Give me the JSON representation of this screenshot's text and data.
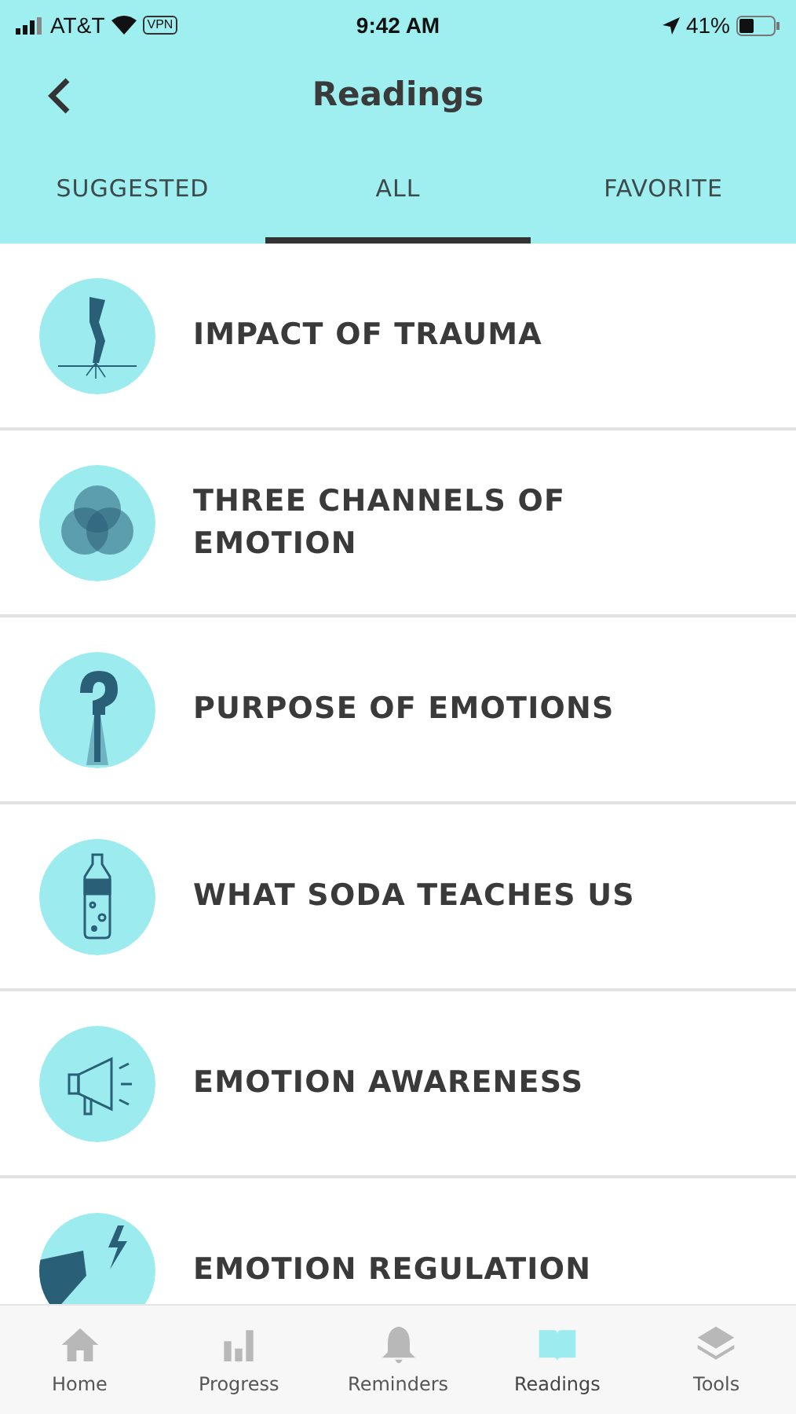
{
  "status_bar": {
    "carrier": "AT&T",
    "vpn": "VPN",
    "time": "9:42 AM",
    "battery": "41%"
  },
  "header": {
    "title": "Readings"
  },
  "tabs": [
    {
      "label": "SUGGESTED",
      "selected": false
    },
    {
      "label": "ALL",
      "selected": true
    },
    {
      "label": "FAVORITE",
      "selected": false
    }
  ],
  "readings": [
    {
      "title": "IMPACT OF TRAUMA"
    },
    {
      "title": "THREE CHANNELS OF EMOTION"
    },
    {
      "title": "PURPOSE OF EMOTIONS"
    },
    {
      "title": "WHAT SODA TEACHES US"
    },
    {
      "title": "EMOTION AWARENESS"
    },
    {
      "title": "EMOTION REGULATION"
    }
  ],
  "tab_bar": [
    {
      "label": "Home",
      "selected": false
    },
    {
      "label": "Progress",
      "selected": false
    },
    {
      "label": "Reminders",
      "selected": false
    },
    {
      "label": "Readings",
      "selected": true
    },
    {
      "label": "Tools",
      "selected": false
    }
  ]
}
